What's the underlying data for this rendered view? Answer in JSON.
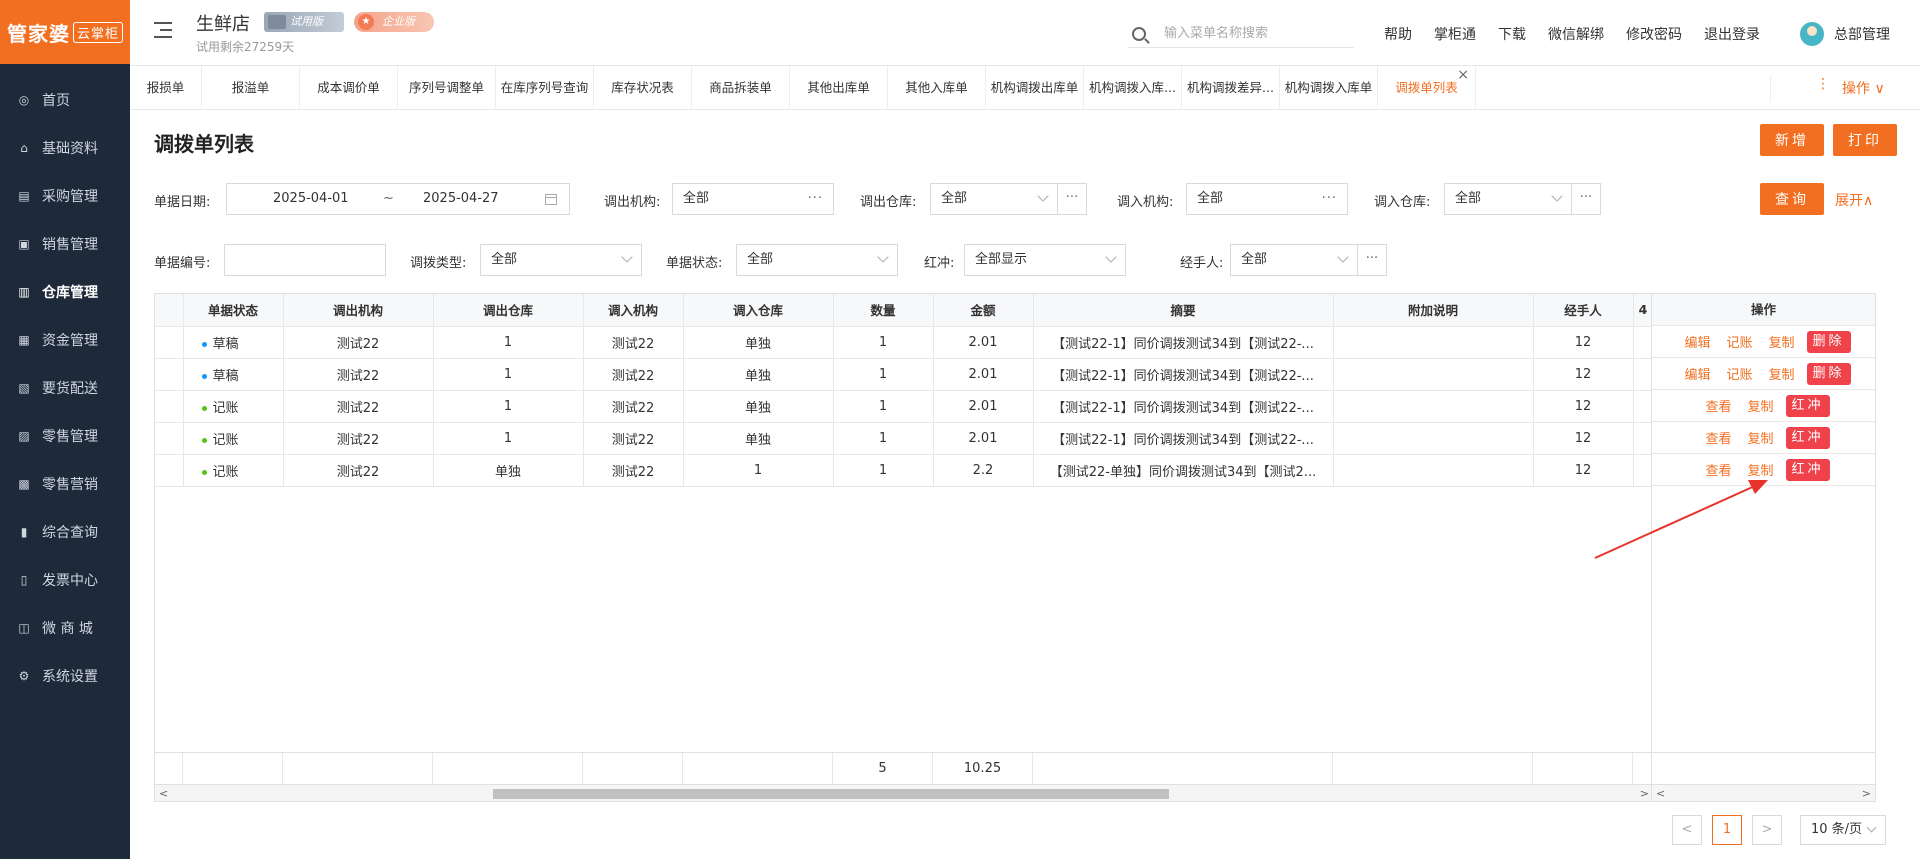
{
  "app": {
    "logo": "管家婆",
    "logo_sub": "云掌柜",
    "store_name": "生鲜店",
    "trial_badge": "试用版",
    "edition_badge": "企业版",
    "trial_remaining": "试用剩余27259天"
  },
  "search": {
    "placeholder": "输入菜单名称搜索"
  },
  "top_links": [
    "帮助",
    "掌柜通",
    "下载",
    "微信解绑",
    "修改密码",
    "退出登录"
  ],
  "user": {
    "name": "总部管理"
  },
  "sidebar": {
    "items": [
      {
        "label": "首页",
        "icon": "globe-icon",
        "glyph": "◎"
      },
      {
        "label": "基础资料",
        "icon": "home-icon",
        "glyph": "⌂"
      },
      {
        "label": "采购管理",
        "icon": "cart-icon",
        "glyph": "▤"
      },
      {
        "label": "销售管理",
        "icon": "sales-icon",
        "glyph": "▣"
      },
      {
        "label": "仓库管理",
        "icon": "warehouse-icon",
        "glyph": "▥"
      },
      {
        "label": "资金管理",
        "icon": "money-icon",
        "glyph": "▦"
      },
      {
        "label": "要货配送",
        "icon": "delivery-icon",
        "glyph": "▧"
      },
      {
        "label": "零售管理",
        "icon": "retail-icon",
        "glyph": "▨"
      },
      {
        "label": "零售营销",
        "icon": "gift-icon",
        "glyph": "▩"
      },
      {
        "label": "综合查询",
        "icon": "chart-icon",
        "glyph": "▮"
      },
      {
        "label": "发票中心",
        "icon": "invoice-icon",
        "glyph": "▯"
      },
      {
        "label": "微 商 城",
        "icon": "shop-icon",
        "glyph": "◫"
      },
      {
        "label": "系统设置",
        "icon": "gear-icon",
        "glyph": "⚙"
      }
    ],
    "active_index": 4
  },
  "tabs": [
    "报损单",
    "报溢单",
    "成本调价单",
    "序列号调整单",
    "在库序列号查询",
    "库存状况表",
    "商品拆装单",
    "其他出库单",
    "其他入库单",
    "机构调拨出库单",
    "机构调拨入库...",
    "机构调拨差异...",
    "机构调拨入库单",
    "调拨单列表"
  ],
  "tabs_active_index": 13,
  "tab_close": "×",
  "tabs_ops": {
    "dots": "⋮",
    "label": "操作 ∨"
  },
  "page": {
    "title": "调拨单列表",
    "add_button": "新增",
    "print_button": "打印",
    "query_button": "查询",
    "expand_link": "展开∧"
  },
  "filters": {
    "date_label": "单据日期:",
    "date_from": "2025-04-01",
    "date_sep": "~",
    "date_to": "2025-04-27",
    "out_org_label": "调出机构:",
    "out_org_value": "全部",
    "out_wh_label": "调出仓库:",
    "out_wh_value": "全部",
    "in_org_label": "调入机构:",
    "in_org_value": "全部",
    "in_wh_label": "调入仓库:",
    "in_wh_value": "全部",
    "doc_no_label": "单据编号:",
    "doc_no_value": "",
    "type_label": "调拨类型:",
    "type_value": "全部",
    "status_label": "单据状态:",
    "status_value": "全部",
    "red_label": "红冲:",
    "red_value": "全部显示",
    "handler_label": "经手人:",
    "handler_value": "全部",
    "more": "···"
  },
  "table": {
    "columns": [
      "",
      "单据状态",
      "调出机构",
      "调出仓库",
      "调入机构",
      "调入仓库",
      "数量",
      "金额",
      "摘要",
      "附加说明",
      "经手人",
      "4"
    ],
    "ops_header": "操作",
    "rows": [
      {
        "status": "草稿",
        "status_color": "#1890ff",
        "out_org": "测试22",
        "out_wh": "1",
        "in_org": "测试22",
        "in_wh": "单独",
        "qty": "1",
        "amount": "2.01",
        "summary": "【测试22-1】同价调拨测试34到【测试22-...",
        "note": "",
        "handler": "12",
        "ops": [
          "编辑",
          "记账",
          "复制"
        ],
        "red_btn": "删除"
      },
      {
        "status": "草稿",
        "status_color": "#1890ff",
        "out_org": "测试22",
        "out_wh": "1",
        "in_org": "测试22",
        "in_wh": "单独",
        "qty": "1",
        "amount": "2.01",
        "summary": "【测试22-1】同价调拨测试34到【测试22-...",
        "note": "",
        "handler": "12",
        "ops": [
          "编辑",
          "记账",
          "复制"
        ],
        "red_btn": "删除"
      },
      {
        "status": "记账",
        "status_color": "#52c41a",
        "out_org": "测试22",
        "out_wh": "1",
        "in_org": "测试22",
        "in_wh": "单独",
        "qty": "1",
        "amount": "2.01",
        "summary": "【测试22-1】同价调拨测试34到【测试22-...",
        "note": "",
        "handler": "12",
        "ops": [
          "查看",
          "复制"
        ],
        "red_btn": "红冲"
      },
      {
        "status": "记账",
        "status_color": "#52c41a",
        "out_org": "测试22",
        "out_wh": "1",
        "in_org": "测试22",
        "in_wh": "单独",
        "qty": "1",
        "amount": "2.01",
        "summary": "【测试22-1】同价调拨测试34到【测试22-...",
        "note": "",
        "handler": "12",
        "ops": [
          "查看",
          "复制"
        ],
        "red_btn": "红冲"
      },
      {
        "status": "记账",
        "status_color": "#52c41a",
        "out_org": "测试22",
        "out_wh": "单独",
        "in_org": "测试22",
        "in_wh": "1",
        "qty": "1",
        "amount": "2.2",
        "summary": "【测试22-单独】同价调拨测试34到【测试2...",
        "note": "",
        "handler": "12",
        "ops": [
          "查看",
          "复制"
        ],
        "red_btn": "红冲"
      }
    ],
    "totals": {
      "qty": "5",
      "amount": "10.25"
    }
  },
  "pagination": {
    "prev": "<",
    "current": "1",
    "next": ">",
    "page_size": "10 条/页"
  },
  "colors": {
    "accent": "#f26f21",
    "danger": "#f0424b",
    "sidebar_bg": "#1e2a3a",
    "arrow": "#e8332a"
  },
  "annotation": {
    "type": "arrow",
    "color": "#e8332a"
  }
}
